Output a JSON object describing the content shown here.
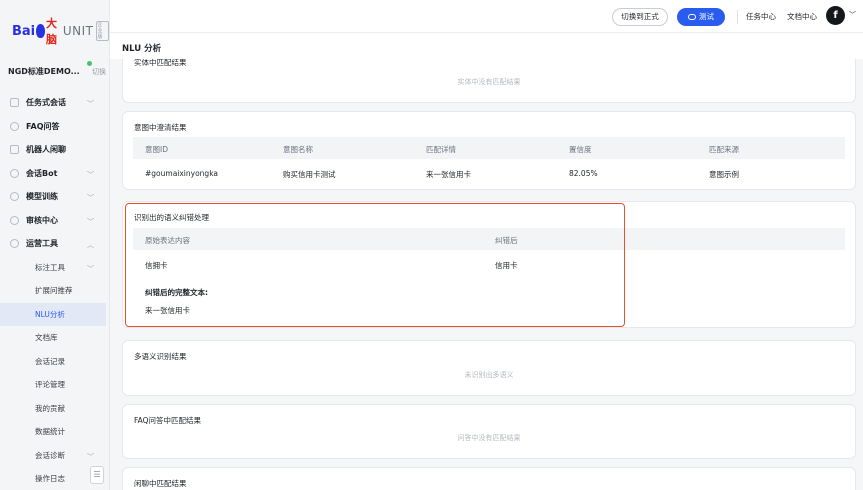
{
  "logo": {
    "bai": "Bai",
    "daxing": "大脑",
    "unit": "UNIT",
    "badge": "企业版"
  },
  "project": {
    "name": "NGD标准DEMO...",
    "switch": "切换"
  },
  "menu": [
    {
      "label": "任务式会话",
      "icon": "dialog-icon",
      "chevron": "﹀"
    },
    {
      "label": "FAQ问答",
      "icon": "faq-icon"
    },
    {
      "label": "机器人闲聊",
      "icon": "chat-robot-icon"
    },
    {
      "label": "会话Bot",
      "icon": "bot-icon",
      "chevron": "﹀"
    },
    {
      "label": "模型训练",
      "icon": "model-icon",
      "chevron": "﹀"
    },
    {
      "label": "审核中心",
      "icon": "shield-icon",
      "chevron": "﹀"
    },
    {
      "label": "运营工具",
      "icon": "tools-icon",
      "chevron": "︿"
    }
  ],
  "submenu": [
    {
      "label": "标注工具",
      "chevron": "﹀"
    },
    {
      "label": "扩展问推荐"
    },
    {
      "label": "NLU分析"
    },
    {
      "label": "文档库"
    },
    {
      "label": "会话记录"
    },
    {
      "label": "评论管理"
    },
    {
      "label": "我的贡献"
    },
    {
      "label": "数据统计"
    },
    {
      "label": "会话诊断",
      "chevron": "﹀"
    },
    {
      "label": "操作日志"
    }
  ],
  "topbar": {
    "switch_label": "切换到正式",
    "test_label": "测试",
    "task_center": "任务中心",
    "doc_center": "文档中心",
    "avatar_letter": "f",
    "avatar_chevron": "﹀"
  },
  "page_title": "NLU 分析",
  "entity_card": {
    "title": "实体中匹配结果",
    "empty": "实体中没有匹配结果"
  },
  "intent_card": {
    "title": "意图中澄清结果",
    "headers": [
      "意图ID",
      "意图名称",
      "匹配详情",
      "置信度",
      "匹配来源"
    ],
    "row": [
      "#goumaixinyongka",
      "购买信用卡测试",
      "来一张信用卡",
      "82.05%",
      "意图示例"
    ]
  },
  "correction_card": {
    "title": "识别出的语义纠错处理",
    "headers": [
      "原始表达内容",
      "纠错后"
    ],
    "row": [
      "信拥卡",
      "信用卡"
    ],
    "full_text_label": "纠错后的完整文本:",
    "full_text": "来一张信用卡"
  },
  "multi_card": {
    "title": "多语义识别结果",
    "empty": "未识别出多语义"
  },
  "faq_card": {
    "title": "FAQ问答中匹配结果",
    "empty": "问答中没有匹配结果"
  },
  "chitchat_card": {
    "title": "闲聊中匹配结果"
  },
  "colors": {
    "accent": "#2a5cf0",
    "highlight": "#e5532f"
  }
}
